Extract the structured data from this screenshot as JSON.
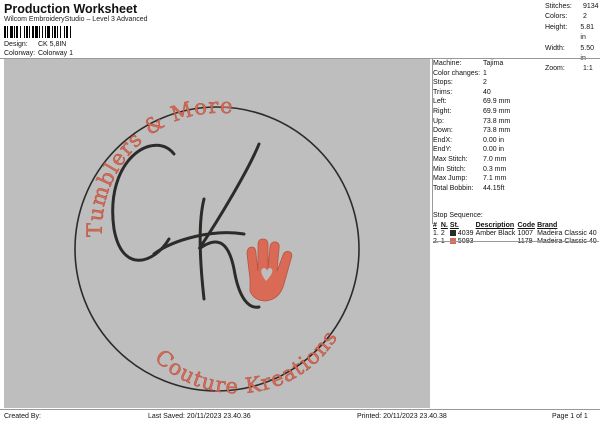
{
  "header": {
    "title": "Production Worksheet",
    "subtitle": "Wilcom EmbroideryStudio – Level 3 Advanced",
    "design_label": "Design:",
    "design_value": "CK 5,8IN",
    "colorway_label": "Colorway:",
    "colorway_value": "Colorway 1"
  },
  "top_stats": [
    {
      "label": "Stitches:",
      "value": "9134"
    },
    {
      "label": "Colors:",
      "value": "2"
    },
    {
      "label": "Height:",
      "value": "5.81 in"
    },
    {
      "label": "Width:",
      "value": "5.50 in"
    },
    {
      "label": "Zoom:",
      "value": "1:1"
    }
  ],
  "design_text": {
    "top_arc": "Tumblers & More",
    "bottom_arc": "Couture Kreations",
    "monogram": "CK"
  },
  "colors": {
    "background": "#bebebe",
    "thread_black": "#2b2b29",
    "thread_red": "#d96a55"
  },
  "machine_info": [
    {
      "label": "Machine:",
      "value": "Tajima"
    },
    {
      "label": "Color changes:",
      "value": "1"
    },
    {
      "label": "Stops:",
      "value": "2"
    },
    {
      "label": "Trims:",
      "value": "40"
    },
    {
      "label": "Left:",
      "value": "69.9 mm"
    },
    {
      "label": "Right:",
      "value": "69.9 mm"
    },
    {
      "label": "Up:",
      "value": "73.8 mm"
    },
    {
      "label": "Down:",
      "value": "73.8 mm"
    },
    {
      "label": "EndX:",
      "value": "0.00 in"
    },
    {
      "label": "EndY:",
      "value": "0.00 in"
    },
    {
      "label": "Max Stitch:",
      "value": "7.0 mm"
    },
    {
      "label": "Min Stitch:",
      "value": "0.3 mm"
    },
    {
      "label": "Max Jump:",
      "value": "7.1 mm"
    },
    {
      "label": "Total Bobbin:",
      "value": "44.15ft"
    }
  ],
  "stop_sequence": {
    "title": "Stop Sequence:",
    "columns": [
      "#",
      "N.",
      "St.",
      "Description",
      "Code",
      "Brand"
    ],
    "rows": [
      {
        "num": "1.",
        "n": "2",
        "st": "4039",
        "description": "Amber Black",
        "code": "1007",
        "brand": "Madeira Classic 40",
        "color": "#2b2b29"
      },
      {
        "num": "2.",
        "n": "1",
        "st": "5093",
        "description": "",
        "code": "1179",
        "brand": "Madeira Classic 40",
        "color": "#d96a55"
      }
    ]
  },
  "footer": {
    "created_by": "Created By:",
    "last_saved": "Last Saved: 20/11/2023 23.40.36",
    "printed": "Printed: 20/11/2023 23.40.38",
    "page": "Page 1 of 1"
  }
}
